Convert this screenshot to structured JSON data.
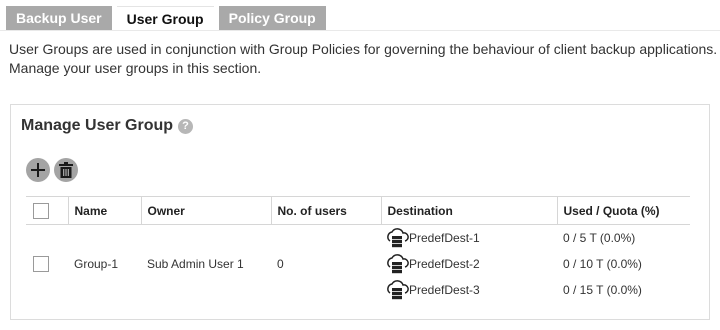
{
  "tabs": [
    {
      "label": "Backup User",
      "active": false
    },
    {
      "label": "User Group",
      "active": true
    },
    {
      "label": "Policy Group",
      "active": false
    }
  ],
  "intro": {
    "line1": "User Groups are used in conjunction with Group Policies for governing the behaviour of client backup applications.",
    "line2": "Manage your user groups in this section."
  },
  "panel": {
    "title": "Manage User Group",
    "help_icon": "?"
  },
  "toolbar": {
    "add_icon": "plus-icon",
    "delete_icon": "trash-icon"
  },
  "table": {
    "headers": [
      "Name",
      "Owner",
      "No. of users",
      "Destination",
      "Used / Quota (%)"
    ],
    "rows": [
      {
        "name": "Group-1",
        "owner": "Sub Admin User 1",
        "users": "0",
        "destinations": [
          {
            "name": "PredefDest-1",
            "quota": "0 / 5 T (0.0%)"
          },
          {
            "name": "PredefDest-2",
            "quota": "0 / 10 T (0.0%)"
          },
          {
            "name": "PredefDest-3",
            "quota": "0 / 15 T (0.0%)"
          }
        ]
      }
    ]
  },
  "colors": {
    "tab_inactive": "#a9a9a9",
    "icon_button": "#a4a4a4",
    "border": "#d6d6d6"
  }
}
